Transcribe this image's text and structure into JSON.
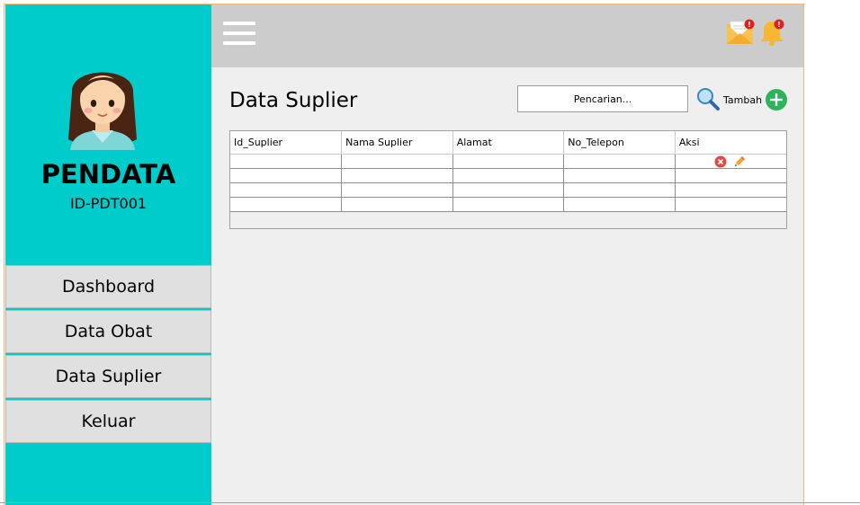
{
  "sidebar": {
    "user_name": "PENDATA",
    "user_id": "ID-PDT001",
    "menu": [
      {
        "label": "Dashboard"
      },
      {
        "label": "Data Obat"
      },
      {
        "label": "Data Suplier"
      },
      {
        "label": "Keluar"
      }
    ],
    "color": "#00cccc"
  },
  "topbar": {
    "menu_icon": "hamburger-icon",
    "mail_icon": "mail-notification-icon",
    "bell_icon": "bell-notification-icon",
    "badge_color": "#e02020"
  },
  "main": {
    "title": "Data Suplier",
    "search": {
      "value": "Pencarian..."
    },
    "add_label": "Tambah",
    "table": {
      "columns": [
        "Id_Suplier",
        "Nama Suplier",
        "Alamat",
        "No_Telepon",
        "Aksi"
      ],
      "rows": [
        [
          "",
          "",
          "",
          "",
          ""
        ],
        [
          "",
          "",
          "",
          "",
          ""
        ],
        [
          "",
          "",
          "",
          "",
          ""
        ],
        [
          "",
          "",
          "",
          "",
          ""
        ]
      ]
    }
  }
}
